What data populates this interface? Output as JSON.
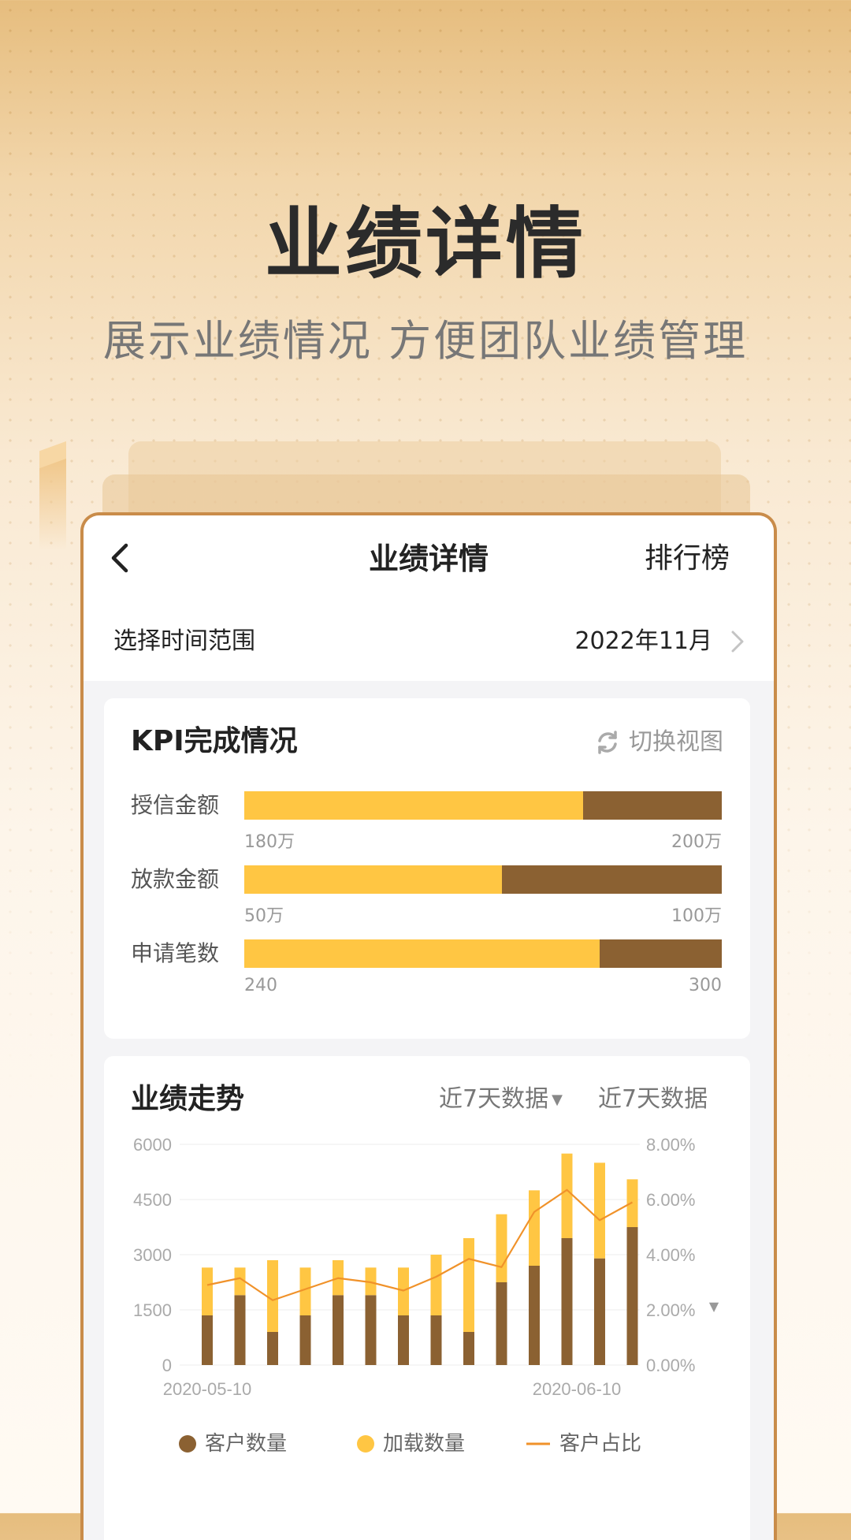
{
  "hero": {
    "title": "业绩详情",
    "subtitle": "展示业绩情况 方便团队业绩管理"
  },
  "nav": {
    "back_icon": "chevron-left-icon",
    "title": "业绩详情",
    "right_label": "排行榜"
  },
  "time_range": {
    "label": "选择时间范围",
    "value": "2022年11月",
    "icon": "chevron-right-icon"
  },
  "kpi": {
    "title": "KPI完成情况",
    "switch_label": "切换视图",
    "switch_icon": "refresh-icon",
    "colors": {
      "done": "#ffc643",
      "remaining": "#8b6132"
    },
    "rows": [
      {
        "label": "授信金额",
        "min": "180万",
        "max": "200万",
        "progress": 0.71
      },
      {
        "label": "放款金额",
        "min": "50万",
        "max": "100万",
        "progress": 0.54
      },
      {
        "label": "申请笔数",
        "min": "240",
        "max": "300",
        "progress": 0.745
      }
    ]
  },
  "trend": {
    "title": "业绩走势",
    "filter_primary": "近7天数据",
    "filter_secondary": "近7天数据",
    "chart_data": {
      "type": "bar",
      "stacked": true,
      "x_tick_labels": [
        "2020-05-10",
        "2020-06-10"
      ],
      "y_left_ticks": [
        "0",
        "1500",
        "3000",
        "4500",
        "6000"
      ],
      "y_right_ticks": [
        "0.00%",
        "2.00%",
        "4.00%",
        "6.00%",
        "8.00%"
      ],
      "ylim_left": [
        0,
        6000
      ],
      "ylim_right": [
        0,
        8
      ],
      "grid": true,
      "series": [
        {
          "name": "客户数量",
          "color": "#8b6132",
          "values": [
            1350,
            1900,
            900,
            1350,
            1900,
            1900,
            1350,
            1350,
            900,
            2250,
            2700,
            3450,
            2900,
            3750
          ]
        },
        {
          "name": "加载数量",
          "color": "#ffc643",
          "values": [
            1300,
            750,
            1950,
            1300,
            950,
            750,
            1300,
            1650,
            2550,
            1850,
            2050,
            2300,
            2600,
            1300
          ]
        },
        {
          "name": "客户占比",
          "color": "#f0922a",
          "type": "line",
          "axis": "right",
          "values": [
            2.9,
            3.15,
            2.35,
            2.75,
            3.15,
            3.0,
            2.7,
            3.2,
            3.85,
            3.55,
            5.55,
            6.35,
            5.25,
            5.9
          ]
        }
      ]
    }
  }
}
